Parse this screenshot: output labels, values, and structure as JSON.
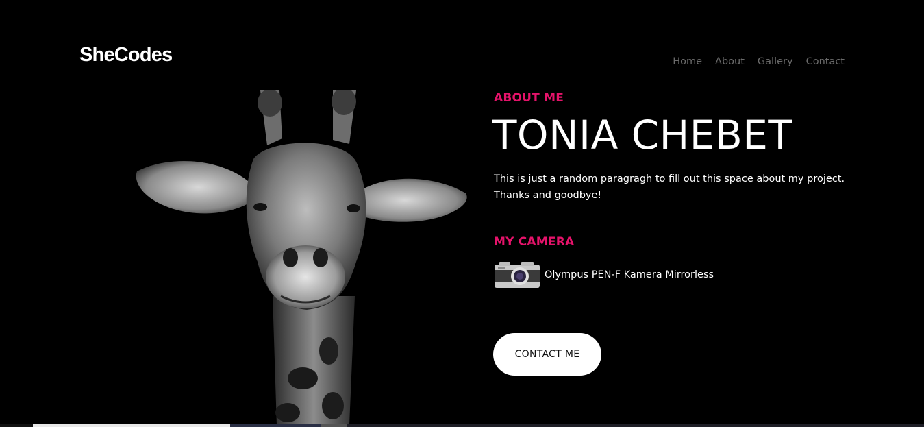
{
  "header": {
    "logo": "SheCodes",
    "nav": [
      {
        "label": "Home"
      },
      {
        "label": "About"
      },
      {
        "label": "Gallery"
      },
      {
        "label": "Contact"
      }
    ]
  },
  "about": {
    "label": "ABOUT ME",
    "name": "TONIA CHEBET",
    "paragraph": "This is just a random paragragh to fill out this space about my project. Thanks and goodbye!"
  },
  "camera": {
    "label": "MY CAMERA",
    "model": "Olympus PEN-F Kamera Mirrorless"
  },
  "cta": {
    "label": "CONTACT ME"
  },
  "colors": {
    "background": "#000000",
    "accent": "#e5136a",
    "nav_text": "#6b6b6b",
    "button_bg": "#ffffff"
  },
  "images": {
    "hero": "giraffe-portrait-bw",
    "camera": "camera-icon"
  }
}
